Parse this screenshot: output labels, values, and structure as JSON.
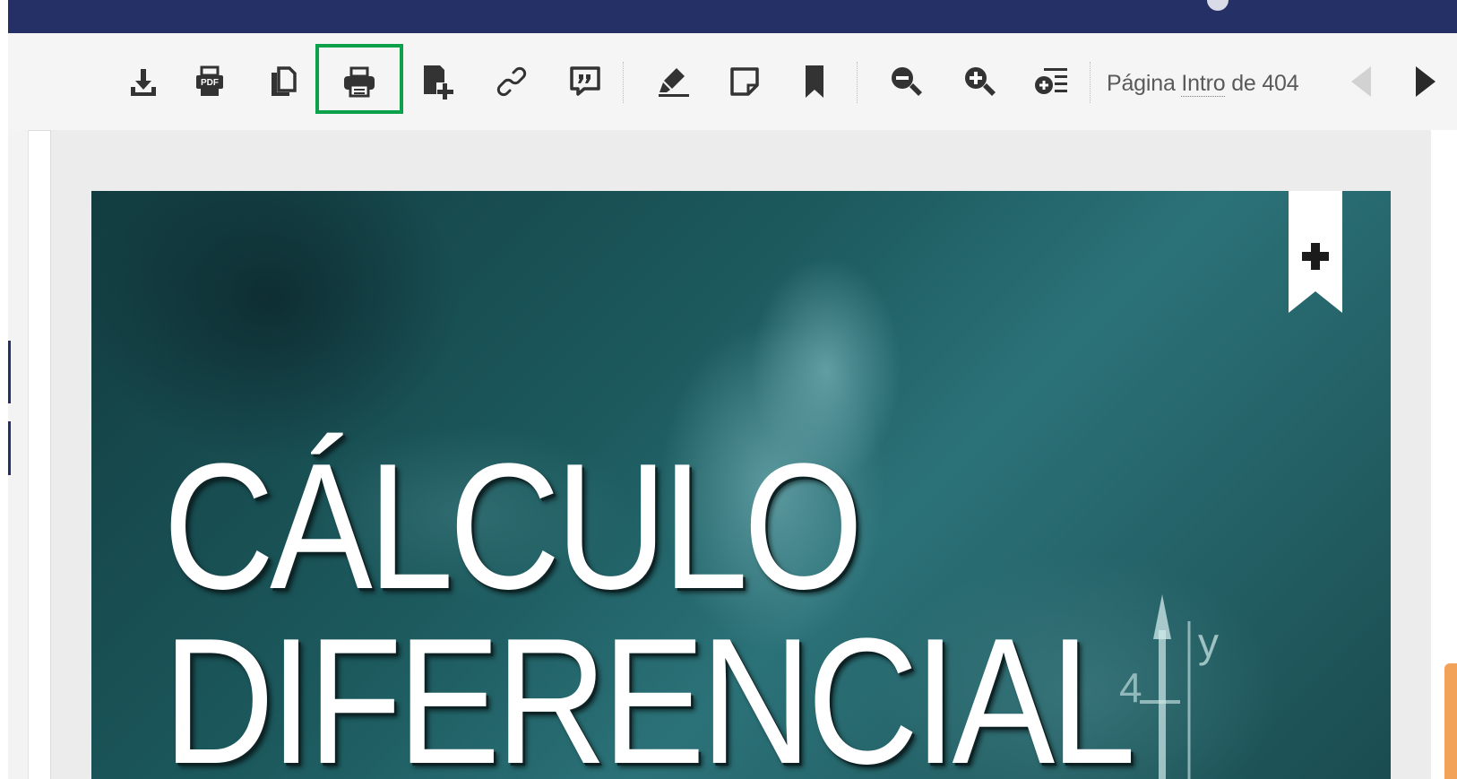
{
  "toolbar": {
    "buttons": [
      {
        "name": "download",
        "icon": "download-icon",
        "highlighted": false
      },
      {
        "name": "pdf",
        "icon": "pdf-icon",
        "highlighted": false
      },
      {
        "name": "copy",
        "icon": "copy-icon",
        "highlighted": false
      },
      {
        "name": "print",
        "icon": "printer-icon",
        "highlighted": true
      },
      {
        "name": "add-page",
        "icon": "add-page-icon",
        "highlighted": false
      },
      {
        "name": "link",
        "icon": "link-icon",
        "highlighted": false
      },
      {
        "name": "cite",
        "icon": "quote-icon",
        "highlighted": false
      },
      {
        "name": "highlight",
        "icon": "highlighter-icon",
        "highlighted": false
      },
      {
        "name": "note",
        "icon": "note-icon",
        "highlighted": false
      },
      {
        "name": "bookmark",
        "icon": "bookmark-icon",
        "highlighted": false
      },
      {
        "name": "zoom-out",
        "icon": "zoom-out-icon",
        "highlighted": false
      },
      {
        "name": "zoom-in",
        "icon": "zoom-in-icon",
        "highlighted": false
      },
      {
        "name": "fit",
        "icon": "zoom-menu-icon",
        "highlighted": false
      }
    ],
    "page_prefix": "Página",
    "page_value": "Intro",
    "page_suffix": "de 404",
    "prev_icon": "prev-page-icon",
    "next_icon": "next-page-icon"
  },
  "cover": {
    "title_line1": "CÁLCULO",
    "title_line2": "DIFERENCIAL",
    "axis_label_y": "y",
    "axis_label_4": "4"
  },
  "colors": {
    "top_bar": "#253166",
    "highlight_box": "#0aa14a",
    "icon": "#333333",
    "cover_bg": "#1c5a5e",
    "accent_tab": "#f3a25a"
  }
}
